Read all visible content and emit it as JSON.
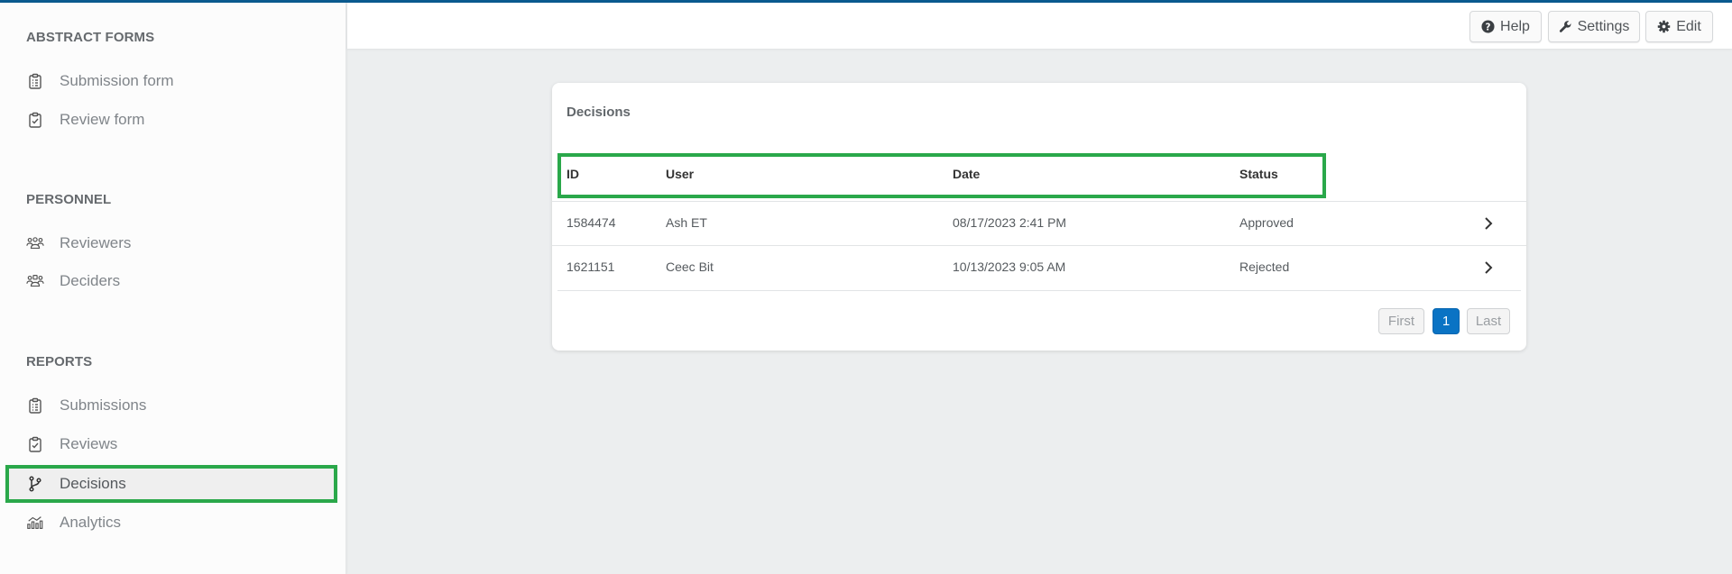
{
  "sidebar": {
    "sections": [
      {
        "heading": "ABSTRACT FORMS",
        "items": [
          {
            "label": "Submission form",
            "icon": "clipboard-list-icon"
          },
          {
            "label": "Review form",
            "icon": "clipboard-check-icon"
          }
        ]
      },
      {
        "heading": "PERSONNEL",
        "items": [
          {
            "label": "Reviewers",
            "icon": "users-icon"
          },
          {
            "label": "Deciders",
            "icon": "users-gavel-icon"
          }
        ]
      },
      {
        "heading": "REPORTS",
        "items": [
          {
            "label": "Submissions",
            "icon": "clipboard-list-icon"
          },
          {
            "label": "Reviews",
            "icon": "clipboard-check-icon"
          },
          {
            "label": "Decisions",
            "icon": "branch-icon",
            "active": true
          },
          {
            "label": "Analytics",
            "icon": "analytics-chart-icon"
          }
        ]
      }
    ]
  },
  "toolbar": {
    "help_label": "Help",
    "settings_label": "Settings",
    "edit_label": "Edit"
  },
  "card": {
    "title": "Decisions",
    "columns": [
      "ID",
      "User",
      "Date",
      "Status"
    ],
    "rows": [
      {
        "id": "1584474",
        "user": "Ash ET",
        "date": "08/17/2023 2:41 PM",
        "status": "Approved"
      },
      {
        "id": "1621151",
        "user": "Ceec Bit",
        "date": "10/13/2023 9:05 AM",
        "status": "Rejected"
      }
    ],
    "pagination": {
      "first_label": "First",
      "current_page": "1",
      "last_label": "Last"
    }
  },
  "colors": {
    "accent_blue": "#0a73c4",
    "top_stripe": "#0b5a8f",
    "highlight_green": "#2aa84a"
  }
}
